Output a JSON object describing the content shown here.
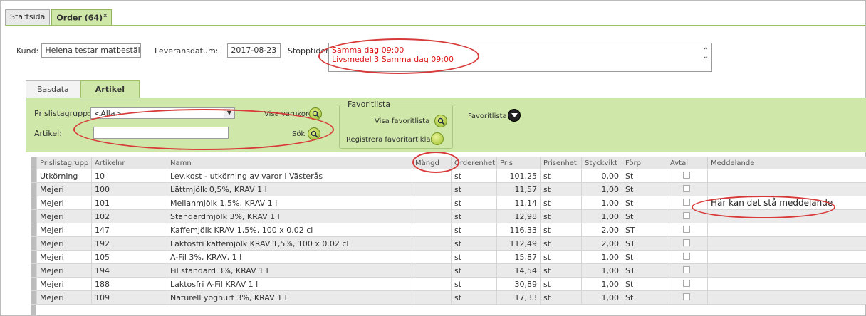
{
  "top_tabs": [
    {
      "label": "Startsida"
    },
    {
      "label": "Order (64)",
      "close": "x"
    }
  ],
  "header": {
    "kund_label": "Kund:",
    "kund_value": "Helena testar matbeställn",
    "lev_label": "Leveransdatum:",
    "lev_value": "2017-08-23",
    "stopp_label": "Stopptider:",
    "stopp_lines": [
      "Samma dag 09:00",
      "Livsmedel 3 Samma dag 09:00"
    ]
  },
  "inner_tabs": [
    {
      "label": "Basdata"
    },
    {
      "label": "Artikel"
    }
  ],
  "filters": {
    "prislista_label": "Prislistagrupp:",
    "prislista_value": "<Alla>",
    "artikel_label": "Artikel:",
    "artikel_value": "",
    "visa_varukorg": "Visa varukorg",
    "sok": "Sök",
    "fav_legend": "Favoritlista",
    "visa_favoritlista": "Visa favoritlista",
    "registrera": "Registrera favoritartiklar",
    "favoritlista": "Favoritlista"
  },
  "table": {
    "columns": [
      "Prislistagrupp",
      "Artikelnr",
      "Namn",
      "Mängd",
      "Orderenhet",
      "Pris",
      "Prisenhet",
      "Styckvikt",
      "Förp",
      "Avtal",
      "Meddelande"
    ],
    "rows": [
      [
        "Utkörning",
        "10",
        "Lev.kost - utkörning av varor i Västerås",
        "",
        "st",
        "101,25",
        "st",
        "0,00",
        "St",
        "",
        ""
      ],
      [
        "Mejeri",
        "100",
        "Lättmjölk 0,5%, KRAV 1 l",
        "",
        "st",
        "11,57",
        "st",
        "1,00",
        "St",
        "",
        ""
      ],
      [
        "Mejeri",
        "101",
        "Mellanmjölk 1,5%, KRAV 1 l",
        "",
        "st",
        "11,14",
        "st",
        "1,00",
        "St",
        "",
        "Här kan det stå meddelande"
      ],
      [
        "Mejeri",
        "102",
        "Standardmjölk 3%, KRAV 1 l",
        "",
        "st",
        "12,98",
        "st",
        "1,00",
        "St",
        "",
        ""
      ],
      [
        "Mejeri",
        "147",
        "Kaffemjölk KRAV 1,5%, 100 x 0.02 cl",
        "",
        "st",
        "116,33",
        "st",
        "2,00",
        "ST",
        "",
        ""
      ],
      [
        "Mejeri",
        "192",
        "Laktosfri kaffemjölk KRAV 1,5%, 100 x 0.02 cl",
        "",
        "st",
        "112,49",
        "st",
        "2,00",
        "ST",
        "",
        ""
      ],
      [
        "Mejeri",
        "105",
        "A-Fil 3%, KRAV, 1 l",
        "",
        "st",
        "15,87",
        "st",
        "1,00",
        "St",
        "",
        ""
      ],
      [
        "Mejeri",
        "194",
        "Fil standard 3%, KRAV 1 l",
        "",
        "st",
        "14,54",
        "st",
        "1,00",
        "ST",
        "",
        ""
      ],
      [
        "Mejeri",
        "188",
        "Laktosfri A-Fil KRAV 1 l",
        "",
        "st",
        "30,89",
        "st",
        "1,00",
        "St",
        "",
        ""
      ],
      [
        "Mejeri",
        "109",
        "Naturell yoghurt 3%, KRAV 1 l",
        "",
        "st",
        "17,33",
        "st",
        "1,00",
        "St",
        "",
        ""
      ]
    ]
  },
  "colors": {
    "green_panel": "#cfe7a8",
    "annotation_red": "#d83a3a",
    "stopp_text": "#dd1111"
  }
}
